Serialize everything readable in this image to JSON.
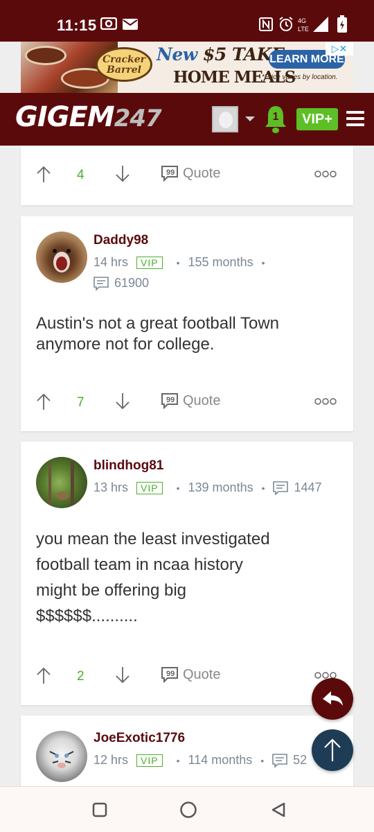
{
  "status_bar": {
    "time": "11:15",
    "icons": [
      "screen-record-icon",
      "mail-icon",
      "nfc-icon",
      "alarm-icon",
      "lte-signal-icon",
      "battery-charging-icon"
    ],
    "network": "4G LTE"
  },
  "ad": {
    "brand": "Cracker Barrel",
    "headline_new": "New",
    "headline_rest": "$5 TAKE",
    "sub": "HOME MEALS",
    "cta": "LEARN MORE",
    "fine_print": "*Price varies by location.",
    "adchoices": "▷✕"
  },
  "navbar": {
    "brand_text": "GIGEM",
    "brand_num": "247",
    "notification_count": "1",
    "vip_label": "VIP+",
    "accent": "#5b0a0c",
    "vip_color": "#5cbf25"
  },
  "posts": [
    {
      "upvotes": "4",
      "quote_label": "Quote"
    },
    {
      "username": "Daddy98",
      "time": "14 hrs",
      "badge": "VIP",
      "tenure": "155 months",
      "post_count": "61900",
      "body_line1": "Austin's not a great football Town",
      "body_line2": "anymore not for college.",
      "upvotes": "7",
      "quote_label": "Quote"
    },
    {
      "username": "blindhog81",
      "time": "13 hrs",
      "badge": "VIP",
      "tenure": "139 months",
      "post_count": "1447",
      "body_line1": "you mean the least investigated",
      "body_line2": "football team in ncaa history",
      "body_line3": "might be offering big",
      "body_line4": "$$$$$$..........",
      "upvotes": "2",
      "quote_label": "Quote"
    },
    {
      "username": "JoeExotic1776",
      "time": "12 hrs",
      "badge": "VIP",
      "tenure": "114 months",
      "post_count": "52"
    }
  ]
}
